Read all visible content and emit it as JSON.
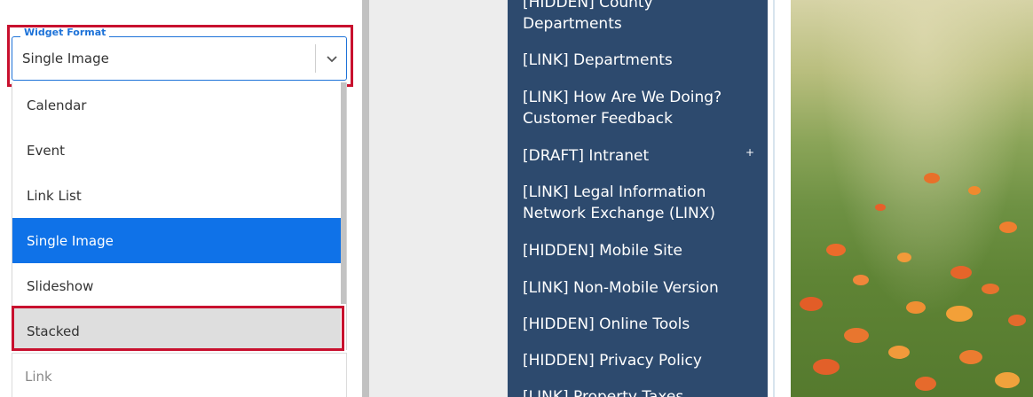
{
  "widget_format": {
    "legend": "Widget Format",
    "selected_value": "Single Image",
    "options": [
      {
        "label": "Calendar"
      },
      {
        "label": "Event"
      },
      {
        "label": "Link List"
      },
      {
        "label": "Single Image"
      },
      {
        "label": "Slideshow"
      },
      {
        "label": "Stacked"
      }
    ],
    "selected_index": 3,
    "hovered_index": 5
  },
  "link_field": {
    "placeholder": "Link"
  },
  "nav_menu": {
    "items": [
      {
        "label": "[HIDDEN] County Departments"
      },
      {
        "label": "[LINK] Departments"
      },
      {
        "label": "[LINK] How Are We Doing? Customer Feedback"
      },
      {
        "label": "[DRAFT] Intranet"
      },
      {
        "label": "[LINK] Legal Information Network Exchange (LINX)"
      },
      {
        "label": "[HIDDEN] Mobile Site"
      },
      {
        "label": "[LINK] Non-Mobile Version"
      },
      {
        "label": "[HIDDEN] Online Tools"
      },
      {
        "label": "[HIDDEN] Privacy Policy"
      },
      {
        "label": "[LINK] Property Taxes"
      }
    ],
    "expand_icon": "+"
  },
  "colors": {
    "accent": "#1d72d8",
    "selected_bg": "#0f72e8",
    "annotation": "#c8102e",
    "nav_bg": "#2d4a6e"
  },
  "icons": {
    "dropdown_toggle": "chevron-down-icon",
    "nav_expand": "plus-icon"
  }
}
